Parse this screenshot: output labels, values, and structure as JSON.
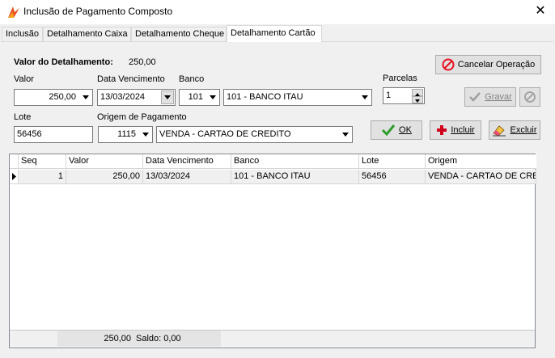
{
  "window": {
    "title": "Inclusão de Pagamento Composto",
    "close_label": "✕"
  },
  "tabs": [
    {
      "label": "Inclusão"
    },
    {
      "label": "Detalhamento Caixa"
    },
    {
      "label": "Detalhamento Cheque"
    },
    {
      "label": "Detalhamento Cartão"
    }
  ],
  "form": {
    "valor_detalhamento_label": "Valor do Detalhamento:",
    "valor_detalhamento_value": "250,00",
    "valor_label": "Valor",
    "valor_value": "250,00",
    "data_vencimento_label": "Data Vencimento",
    "data_vencimento_value": "13/03/2024",
    "banco_label": "Banco",
    "banco_code": "101",
    "banco_name": "101 - BANCO ITAU",
    "parcelas_label": "Parcelas",
    "parcelas_value": "1",
    "lote_label": "Lote",
    "lote_value": "56456",
    "origem_label": "Origem de Pagamento",
    "origem_code": "1115",
    "origem_name": "VENDA - CARTAO DE CREDITO"
  },
  "buttons": {
    "cancelar": "Cancelar Operação",
    "gravar": "Gravar",
    "ok": "OK",
    "incluir": "Incluir",
    "excluir": "Excluir"
  },
  "grid": {
    "columns": [
      "Seq",
      "Valor",
      "Data Vencimento",
      "Banco",
      "Lote",
      "Origem"
    ],
    "rows": [
      {
        "seq": "1",
        "valor": "250,00",
        "data": "13/03/2024",
        "banco": "101 - BANCO ITAU",
        "lote": "56456",
        "origem": "VENDA - CARTAO DE CREDI"
      }
    ],
    "footer_total": "250,00",
    "footer_saldo": "Saldo: 0,00"
  },
  "colors": {
    "accent_cancel": "#e81123",
    "accent_ok": "#2e9e2e"
  }
}
